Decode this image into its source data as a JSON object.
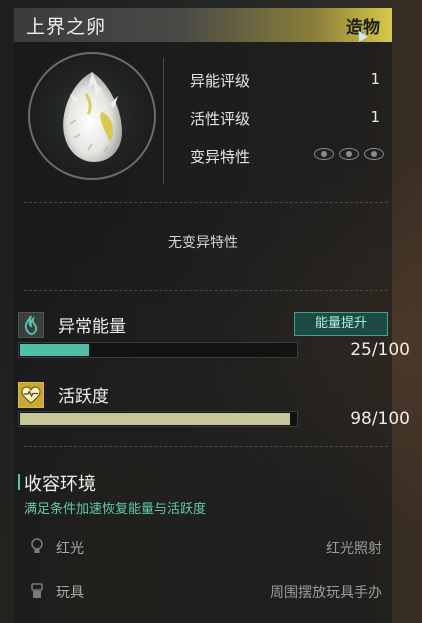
{
  "item": {
    "name": "上界之卵",
    "type": "造物"
  },
  "stats": [
    {
      "label": "异能评级",
      "value": "1"
    },
    {
      "label": "活性评级",
      "value": "1"
    },
    {
      "label": "变异特性",
      "value": ""
    }
  ],
  "mutation_text": "无变异特性",
  "energy": {
    "title": "异常能量",
    "button": "能量提升",
    "value_text": "25/100",
    "fill_fraction": 0.25,
    "fill_color": "#4fc0a8",
    "icon": "flame-icon"
  },
  "activity": {
    "title": "活跃度",
    "value_text": "98/100",
    "fill_fraction": 0.98,
    "fill_color": "#c6c79a",
    "icon": "heart-pulse-icon"
  },
  "environment": {
    "title": "收容环境",
    "description": "满足条件加速恢复能量与活跃度",
    "rows": [
      {
        "name": "红光",
        "condition": "红光照射",
        "icon": "bulb-icon"
      },
      {
        "name": "玩具",
        "condition": "周围摆放玩具手办",
        "icon": "toy-icon"
      }
    ]
  },
  "colors": {
    "accent": "#4fc0a8",
    "header_gold": "#d8c84a"
  }
}
